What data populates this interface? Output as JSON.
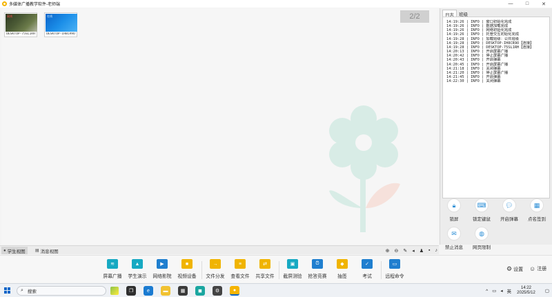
{
  "window": {
    "title": "多媒体广播教学软件-老师端",
    "controls": [
      "—",
      "□",
      "✕"
    ]
  },
  "desktop": {
    "page_indicator": "2/2",
    "thumbnails": [
      {
        "name": "DESKTOP-75SL1RH",
        "tag": "离线"
      },
      {
        "name": "DESKTOP-IH8CR9O",
        "tag": "在线"
      }
    ]
  },
  "right_panel": {
    "tabs": [
      "日志",
      "班级"
    ],
    "log": [
      "14:19:26 | INFO | 窗口初始化完成",
      "14:19:26 | INFO | 数据加载完成",
      "14:19:26 | INFO | 网络初始化完成",
      "14:19:26 | INFO | 托管交互初始化完成",
      "14:19:28 | INFO | 加载班级：公共班级",
      "14:19:28 | INFO | DESKTOP-IH8CR9O【连接】",
      "14:19:28 | INFO | DESKTOP-75SL1RH【连接】",
      "14:20:13 | INFO | 开启屏幕广播",
      "14:20:42 | INFO | 停止屏幕广播",
      "14:20:43 | INFO | 开启弹幕",
      "14:20:45 | INFO | 开启屏幕广播",
      "14:21:18 | INFO | 关闭弹幕",
      "14:21:20 | INFO | 停止屏幕广播",
      "14:21:45 | INFO | 开启弹幕",
      "14:22:30 | INFO | 关闭弹幕"
    ],
    "actions": [
      {
        "label": "锁屏",
        "icon": "lock-icon"
      },
      {
        "label": "锁定键鼠",
        "icon": "keyboard-icon"
      },
      {
        "label": "开启弹幕",
        "icon": "chat-bubble-icon"
      },
      {
        "label": "点名签到",
        "icon": "calendar-check-icon"
      },
      {
        "label": "禁止消息",
        "icon": "mail-icon"
      },
      {
        "label": "网页限制",
        "icon": "globe-icon"
      }
    ]
  },
  "view_tabs": {
    "student_view": "学生视图",
    "message_view": "消息视图"
  },
  "toolbar": {
    "items": [
      {
        "label": "屏幕广播",
        "icon": "broadcast-icon",
        "color": "#17a9c2"
      },
      {
        "label": "学生演示",
        "icon": "graduation-cap-icon",
        "color": "#17a9c2"
      },
      {
        "label": "网络影院",
        "icon": "play-icon",
        "color": "#1f7fcf"
      },
      {
        "label": "视频设备",
        "icon": "camera-icon",
        "color": "#f0b400"
      },
      {
        "label": "文件分发",
        "icon": "file-send-icon",
        "color": "#f0b400"
      },
      {
        "label": "查看文件",
        "icon": "file-view-icon",
        "color": "#f0b400"
      },
      {
        "label": "共享文件",
        "icon": "folder-share-icon",
        "color": "#f0b400"
      },
      {
        "label": "截屏测验",
        "icon": "screenshot-icon",
        "color": "#17a9c2"
      },
      {
        "label": "抢答竞赛",
        "icon": "alarm-icon",
        "color": "#1f7fcf"
      },
      {
        "label": "抽签",
        "icon": "box-icon",
        "color": "#f0b400"
      },
      {
        "label": "考试",
        "icon": "exam-icon",
        "color": "#1f7fcf"
      },
      {
        "label": "远程命令",
        "icon": "monitor-icon",
        "color": "#1f7fcf"
      }
    ],
    "settings": "设置",
    "register": "注册"
  },
  "taskbar": {
    "search": "搜索",
    "lang": "英",
    "time": "14:22",
    "date": "2025/5/12"
  }
}
